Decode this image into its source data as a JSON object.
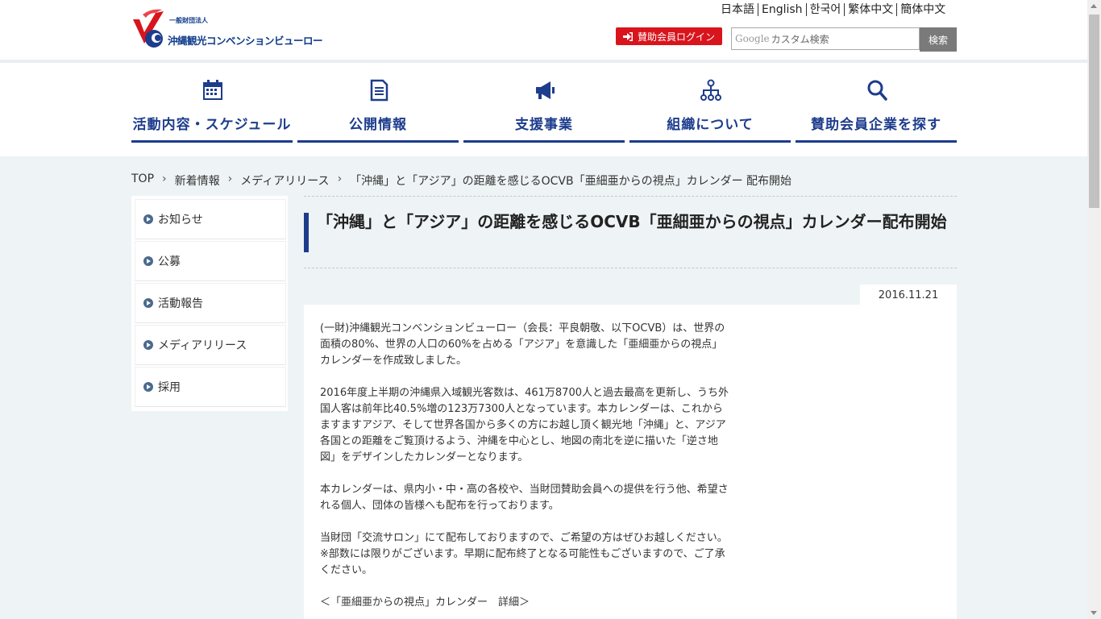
{
  "header": {
    "logo_small": "一般財団法人",
    "logo_text": "沖縄観光コンベンションビューロー",
    "languages": [
      "日本語",
      "English",
      "한국어",
      "繁体中文",
      "簡体中文"
    ],
    "login_label": "賛助会員ログイン",
    "search_google": "Google",
    "search_placeholder": "カスタム検索",
    "search_button": "検索"
  },
  "nav": [
    {
      "label": "活動内容・スケジュール",
      "icon": "calendar-icon"
    },
    {
      "label": "公開情報",
      "icon": "document-icon"
    },
    {
      "label": "支援事業",
      "icon": "megaphone-icon"
    },
    {
      "label": "組織について",
      "icon": "org-chart-icon"
    },
    {
      "label": "賛助会員企業を探す",
      "icon": "search-icon"
    }
  ],
  "breadcrumb": [
    "TOP",
    "新着情報",
    "メディアリリース",
    "「沖縄」と「アジア」の距離を感じるOCVB「亜細亜からの視点」カレンダー 配布開始"
  ],
  "sidebar": [
    "お知らせ",
    "公募",
    "活動報告",
    "メディアリリース",
    "採用"
  ],
  "article": {
    "title": "「沖縄」と「アジア」の距離を感じるOCVB「亜細亜からの視点」カレンダー配布開始",
    "date": "2016.11.21",
    "p1": "(一財)沖縄観光コンベンションビューロー（会長：平良朝敬、以下OCVB）は、世界の面積の80%、世界の人口の60%を占める「アジア」を意識した「亜細亜からの視点」カレンダーを作成致しました。",
    "p2": "2016年度上半期の沖縄県入域観光客数は、461万8700人と過去最高を更新し、うち外国人客は前年比40.5%増の123万7300人となっています。本カレンダーは、これからますますアジア、そして世界各国から多くの方にお越し頂く観光地「沖縄」と、アジア各国との距離をご覧頂けるよう、沖縄を中心とし、地図の南北を逆に描いた「逆さ地図」をデザインしたカレンダーとなります。",
    "p3": "本カレンダーは、県内小・中・高の各校や、当財団賛助会員への提供を行う他、希望される個人、団体の皆様へも配布を行っております。",
    "p4a": "当財団「交流サロン」にて配布しておりますので、ご希望の方はぜひお越しください。",
    "p4b": "※部数には限りがございます。早期に配布終了となる可能性もございますので、ご了承ください。",
    "p5": "＜「亜細亜からの視点」カレンダー　詳細＞"
  },
  "colors": {
    "brand_blue": "#1d3c8c",
    "login_red": "#d8141c"
  }
}
